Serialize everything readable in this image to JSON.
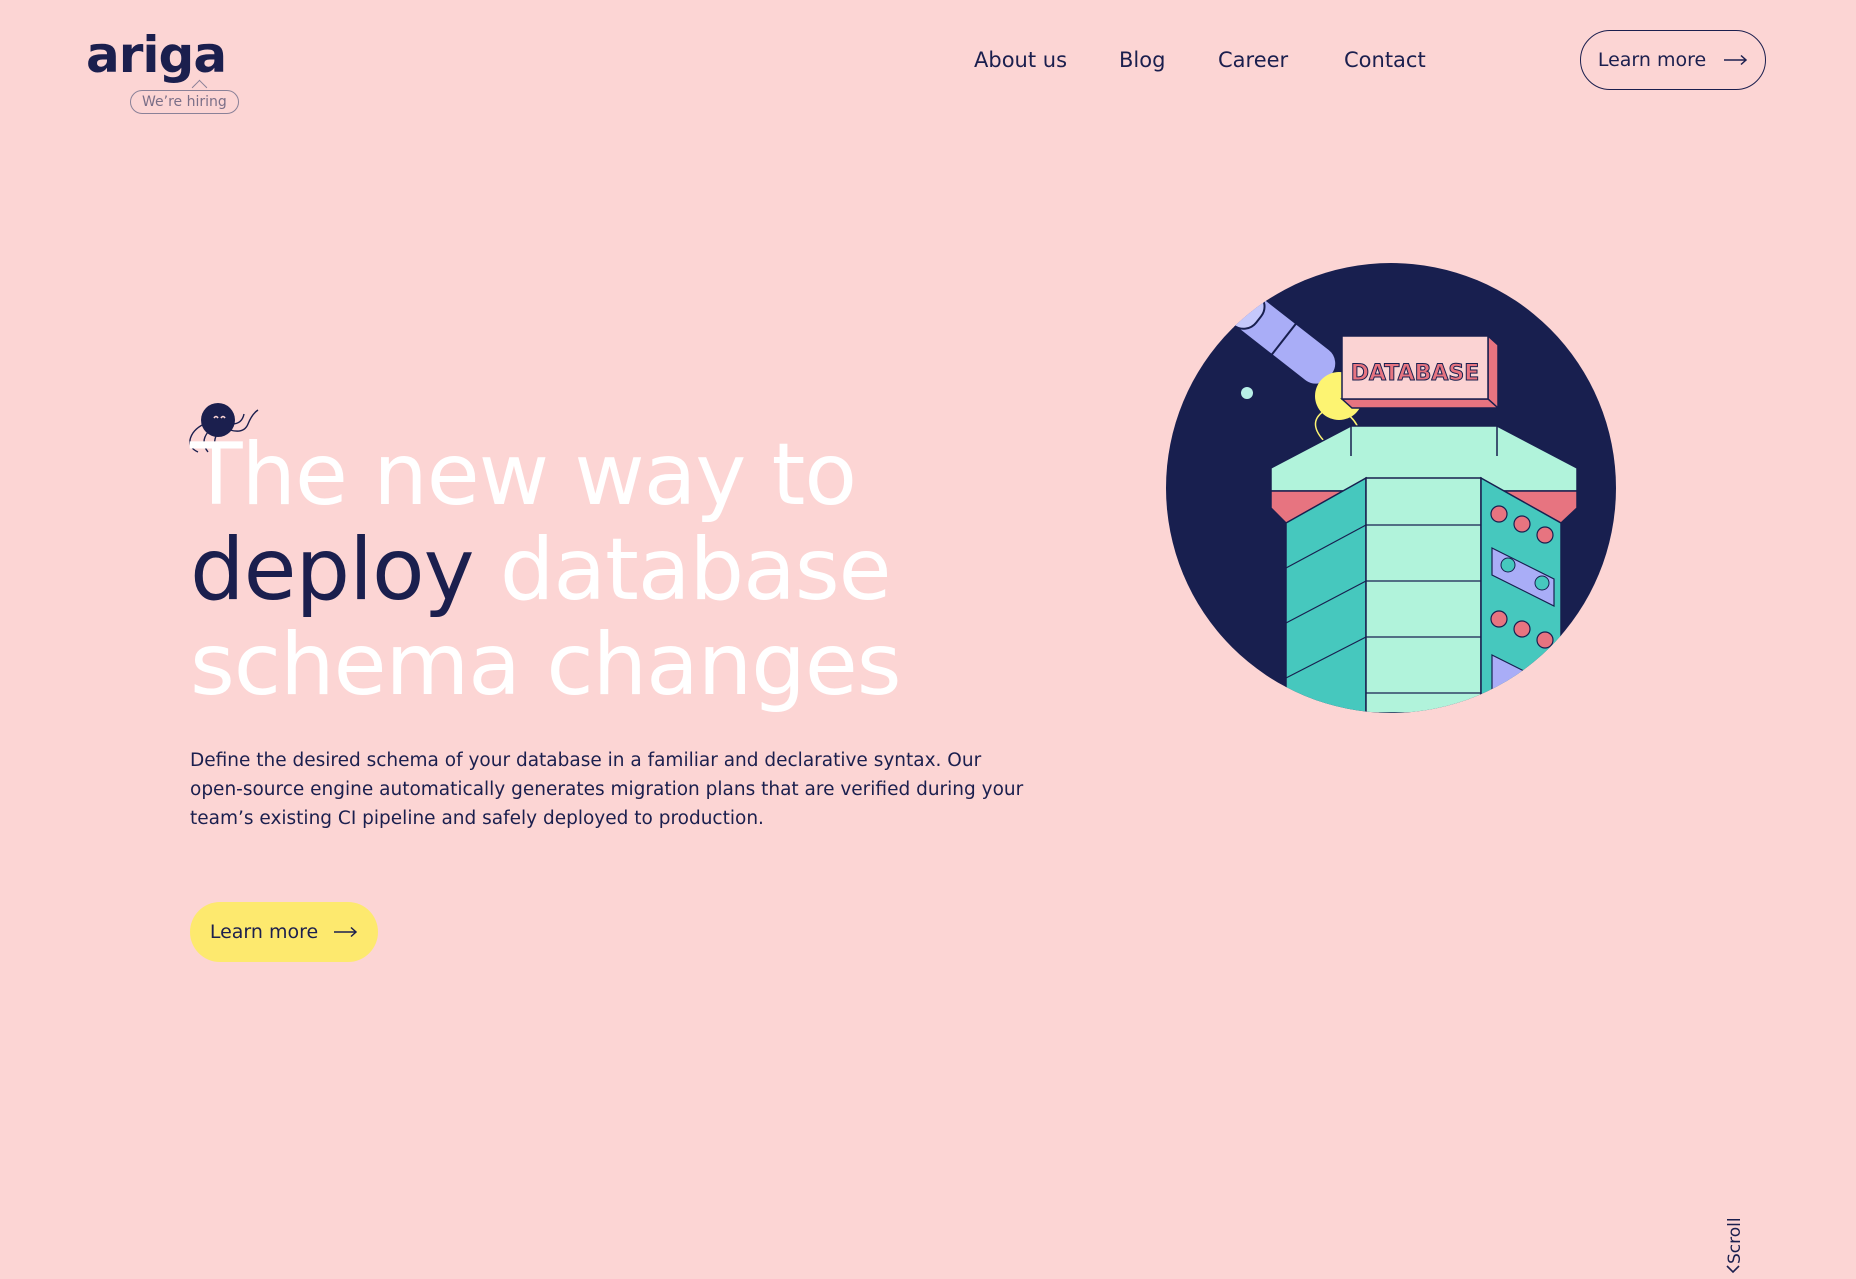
{
  "brand": {
    "logo_text": "ariga",
    "hiring_badge": "We’re hiring"
  },
  "nav": {
    "items": [
      {
        "label": "About us"
      },
      {
        "label": "Blog"
      },
      {
        "label": "Career"
      },
      {
        "label": "Contact"
      }
    ],
    "cta_label": "Learn more"
  },
  "hero": {
    "headline_part1": "The new way to",
    "headline_highlight": "deploy",
    "headline_part2": " database",
    "headline_part3": "schema changes",
    "description": "Define the desired schema of your database in a familiar and declarative syntax. Our open-source engine automatically generates migration plans that are verified during your team’s existing CI pipeline and safely deployed to production.",
    "cta_label": "Learn more",
    "illustration_label": "DATABASE"
  },
  "scroll_label": "Scroll",
  "colors": {
    "background": "#fcd5d4",
    "navy": "#1b1f4e",
    "yellow": "#fde96e",
    "teal": "#46c8be",
    "mint": "#b1f3db",
    "coral": "#e77480",
    "lavender": "#a9adf7"
  },
  "icons": {
    "arrow": "right-arrow-icon",
    "scroll": "chevron-down-icon",
    "mascot": "octopus-mascot-icon"
  }
}
